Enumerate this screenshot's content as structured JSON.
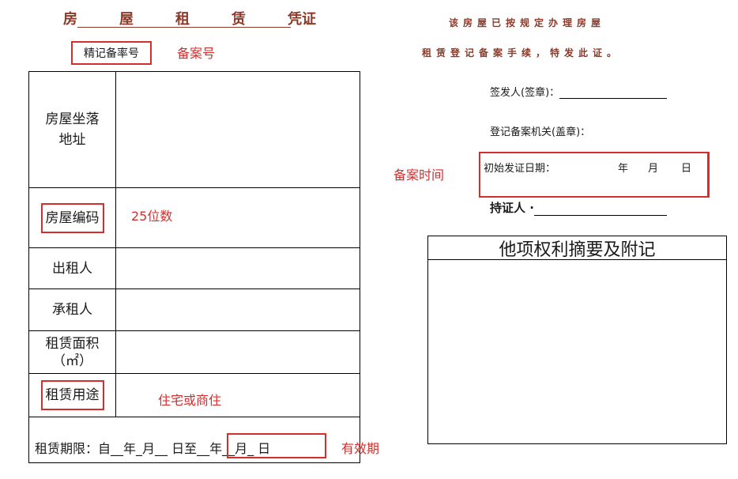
{
  "header": {
    "title_chars": [
      "房",
      "屋",
      "租",
      "赁",
      "凭证"
    ],
    "reg_label": "精记备率号",
    "reg_annotation": "备案号"
  },
  "table": {
    "rows": [
      {
        "label": "房屋坐落\n地址"
      },
      {
        "label": "房屋编码",
        "annotation": "25位数"
      },
      {
        "label": "出租人"
      },
      {
        "label": "承租人"
      },
      {
        "label": "租赁面积\n（㎡）"
      },
      {
        "label": "租赁用途",
        "annotation": "住宅或商住"
      }
    ],
    "period_text": "租赁期限：自__年_月__ 日至__年__月_ 日",
    "period_annotation": "有效期"
  },
  "right": {
    "notice_line1": "该房屋已按规定办理房屋",
    "notice_line2": "租赁登记备案手续，特发此证。",
    "issuer_label": "签发人(签章)：",
    "agency_label": "登记备案机关(盖章)：",
    "date_label": "初始发证日期：",
    "date_year": "年",
    "date_month": "月",
    "date_day": "日",
    "date_annotation": "备案时间",
    "holder_label": "持证人 ·",
    "rights_title": "他项权利摘要及附记"
  },
  "colors": {
    "annotation_red": "#d32f2f",
    "title_brown": "#8b3a2a"
  }
}
